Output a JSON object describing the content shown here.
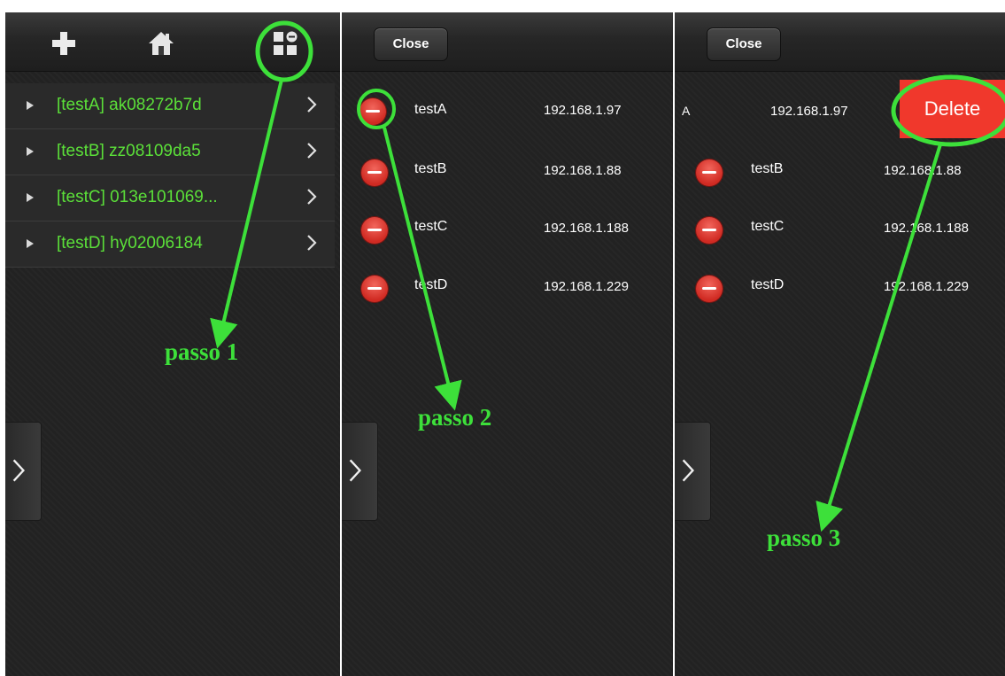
{
  "panel1": {
    "toolbar_icons": [
      "plus-icon",
      "home-icon",
      "grid-edit-icon"
    ],
    "devices": [
      {
        "label": "[testA] ak08272b7d"
      },
      {
        "label": "[testB] zz08109da5"
      },
      {
        "label": "[testC] 013e101069..."
      },
      {
        "label": "[testD] hy02006184"
      }
    ]
  },
  "panel2": {
    "close_label": "Close",
    "devices": [
      {
        "name": "testA",
        "ip": "192.168.1.97"
      },
      {
        "name": "testB",
        "ip": "192.168.1.88"
      },
      {
        "name": "testC",
        "ip": "192.168.1.188"
      },
      {
        "name": "testD",
        "ip": "192.168.1.229"
      }
    ]
  },
  "panel3": {
    "close_label": "Close",
    "swiped_row": {
      "name_fragment": "A",
      "ip": "192.168.1.97",
      "delete_label": "Delete"
    },
    "devices": [
      {
        "name": "testB",
        "ip": "192.168.1.88"
      },
      {
        "name": "testC",
        "ip": "192.168.1.188"
      },
      {
        "name": "testD",
        "ip": "192.168.1.229"
      }
    ]
  },
  "annotations": {
    "step1": "passo 1",
    "step2": "passo 2",
    "step3": "passo 3"
  },
  "colors": {
    "accent_green": "#3de03a",
    "device_label_green": "#5be039",
    "delete_red": "#f0382c",
    "panel_bg": "#222222"
  }
}
